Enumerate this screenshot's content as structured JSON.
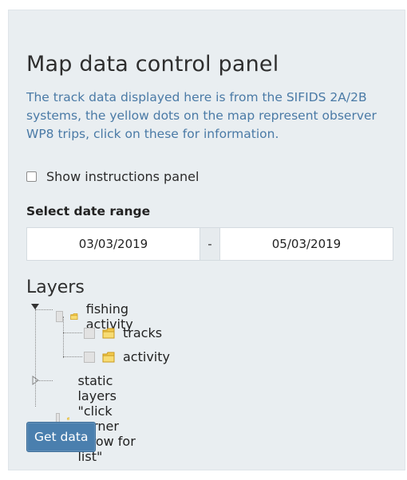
{
  "panel": {
    "title": "Map data control panel",
    "description": "The track data displayed here is from the SIFIDS 2A/2B systems, the yellow dots on the map represent observer WP8 trips, click on these for information.",
    "show_instructions_label": "Show instructions panel",
    "show_instructions_checked": false,
    "date_range_label": "Select date range",
    "date_start": "03/03/2019",
    "date_separator": "-",
    "date_end": "05/03/2019",
    "layers_label": "Layers",
    "layers": [
      {
        "label": "fishing activity",
        "expanded": true,
        "children": [
          {
            "label": "tracks"
          },
          {
            "label": "activity"
          }
        ]
      },
      {
        "label": "static layers \"click corner arrow for list\"",
        "expanded": false
      }
    ],
    "get_data_label": "Get data"
  },
  "colors": {
    "panel_bg": "#e9eef1",
    "description_text": "#4a7aa6",
    "button_bg": "#4a7fae"
  }
}
